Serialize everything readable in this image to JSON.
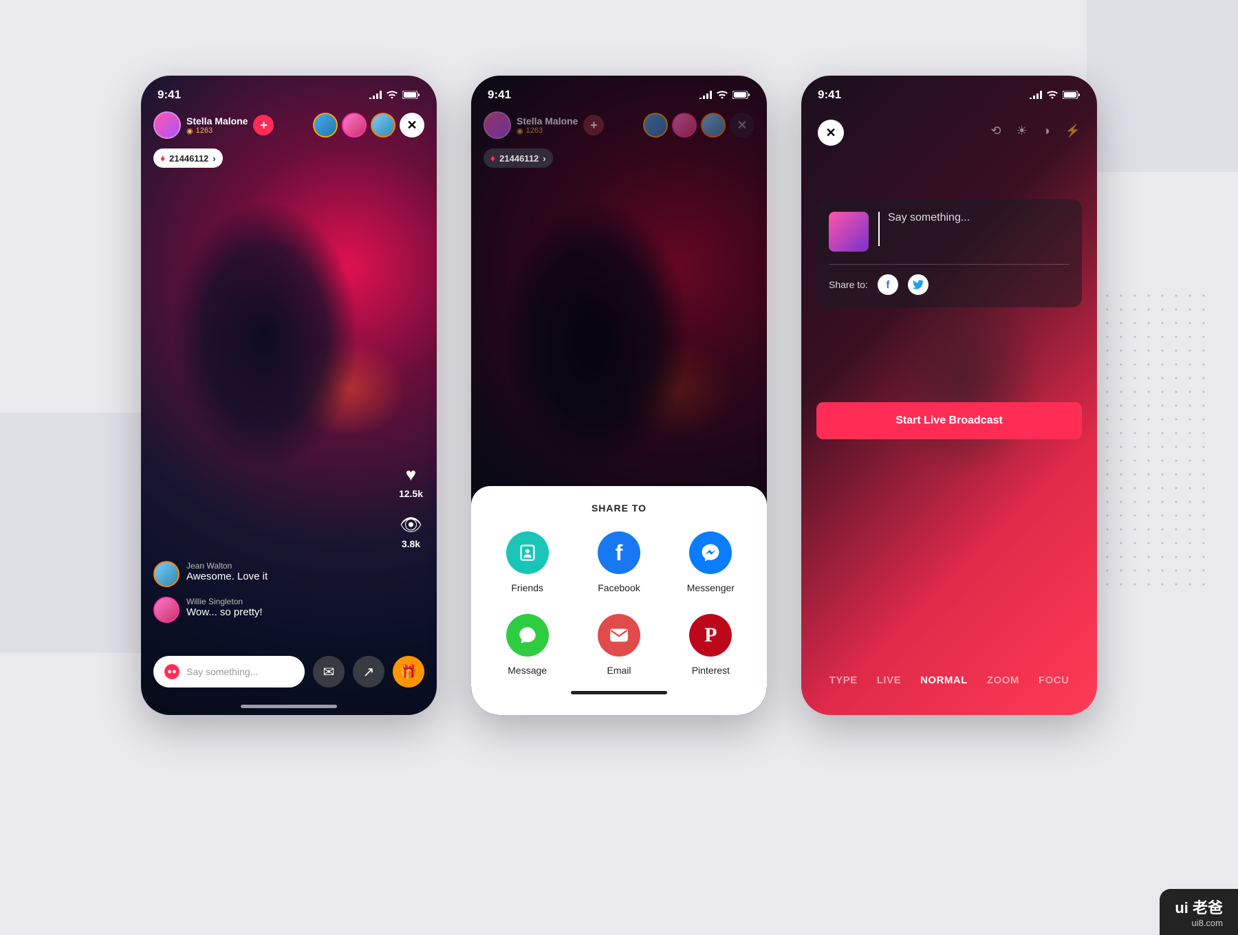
{
  "statusbar": {
    "time": "9:41"
  },
  "streamer": {
    "name": "Stella Malone",
    "views": "1263"
  },
  "gems": "21446112",
  "stats": {
    "likes": "12.5k",
    "watching": "3.8k"
  },
  "comments": [
    {
      "name": "Jean Walton",
      "text": "Awesome. Love it"
    },
    {
      "name": "Willie Singleton",
      "text": "Wow... so pretty!"
    }
  ],
  "chat": {
    "placeholder": "Say something..."
  },
  "share": {
    "title": "SHARE TO",
    "items": [
      {
        "label": "Friends",
        "color": "#19c6b5",
        "glyph": "friends"
      },
      {
        "label": "Facebook",
        "color": "#1877f2",
        "glyph": "f"
      },
      {
        "label": "Messenger",
        "color": "#0a7cff",
        "glyph": "msgr"
      },
      {
        "label": "Message",
        "color": "#2ecc40",
        "glyph": "msg"
      },
      {
        "label": "Email",
        "color": "#e14b4b",
        "glyph": "mail"
      },
      {
        "label": "Pinterest",
        "color": "#bd081c",
        "glyph": "P"
      }
    ]
  },
  "broadcast": {
    "caption_placeholder": "Say something...",
    "share_to_label": "Share to:",
    "start_label": "Start Live Broadcast",
    "modes": [
      "TYPE",
      "LIVE",
      "NORMAL",
      "ZOOM",
      "FOCU"
    ],
    "active_mode": "NORMAL"
  },
  "watermark": {
    "brand": "ui 老爸",
    "site": "ui8.com"
  }
}
